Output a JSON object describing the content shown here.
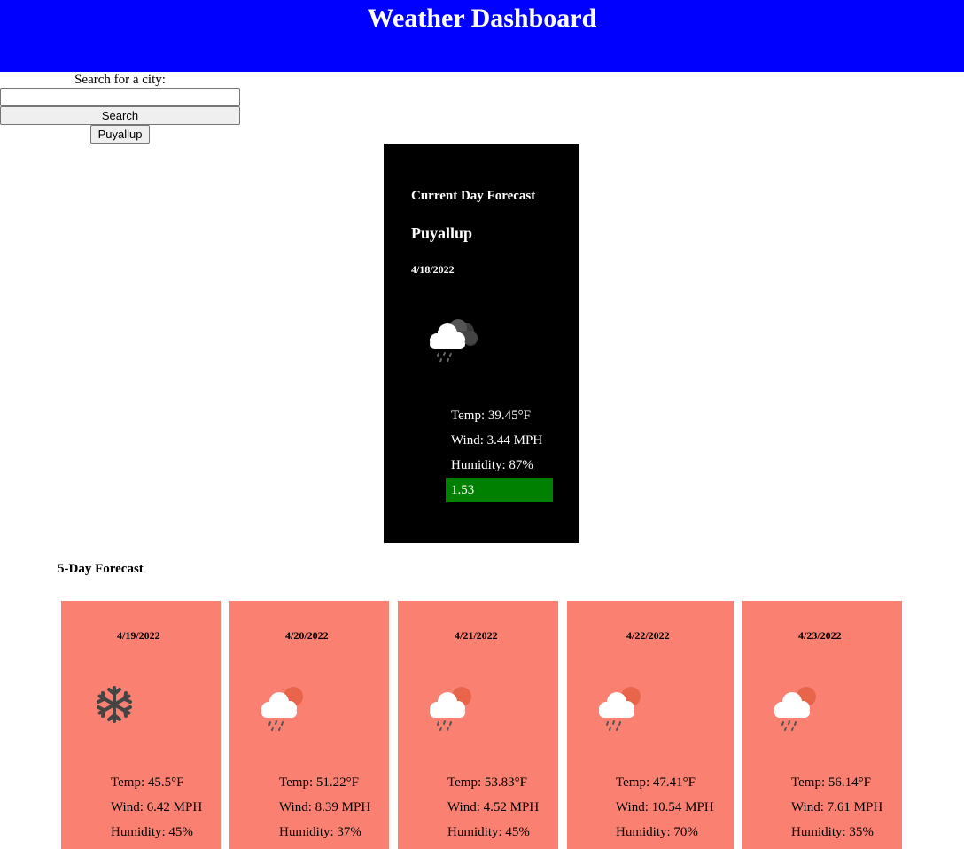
{
  "header": {
    "title": "Weather Dashboard"
  },
  "search": {
    "label": "Search for a city:",
    "input_value": "",
    "placeholder": "",
    "button_label": "Search",
    "history": [
      "Puyallup"
    ]
  },
  "current": {
    "heading": "Current Day Forecast",
    "city": "Puyallup",
    "date": "4/18/2022",
    "icon": "rain-cloud-icon",
    "temp": "Temp: 39.45°F",
    "wind": "Wind: 3.44 MPH",
    "humidity": "Humidity: 87%",
    "uv_index": "1.53",
    "uv_color": "#008000"
  },
  "forecast": {
    "heading": "5-Day Forecast",
    "days": [
      {
        "date": "4/19/2022",
        "icon": "snowflake-icon",
        "temp": "Temp: 45.5°F",
        "wind": "Wind: 6.42 MPH",
        "humidity": "Humidity: 45%"
      },
      {
        "date": "4/20/2022",
        "icon": "sun-rain-cloud-icon",
        "temp": "Temp: 51.22°F",
        "wind": "Wind: 8.39 MPH",
        "humidity": "Humidity: 37%"
      },
      {
        "date": "4/21/2022",
        "icon": "sun-rain-cloud-icon",
        "temp": "Temp: 53.83°F",
        "wind": "Wind: 4.52 MPH",
        "humidity": "Humidity: 45%"
      },
      {
        "date": "4/22/2022",
        "icon": "sun-rain-cloud-icon",
        "temp": "Temp: 47.41°F",
        "wind": "Wind: 10.54 MPH",
        "humidity": "Humidity: 70%"
      },
      {
        "date": "4/23/2022",
        "icon": "sun-rain-cloud-icon",
        "temp": "Temp: 56.14°F",
        "wind": "Wind: 7.61 MPH",
        "humidity": "Humidity: 35%"
      }
    ]
  },
  "colors": {
    "header_bg": "#0000ff",
    "current_card_bg": "#000000",
    "forecast_card_bg": "#fa8072",
    "uv_low": "#008000"
  }
}
